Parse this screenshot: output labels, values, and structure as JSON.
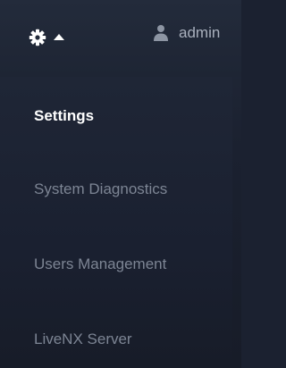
{
  "header": {
    "settings_icon": "gear-icon",
    "toggle_icon": "caret-up-icon",
    "user_icon": "user-icon",
    "username": "admin"
  },
  "menu": {
    "items": [
      {
        "label": "Settings",
        "active": true
      },
      {
        "label": "System Diagnostics",
        "active": false
      },
      {
        "label": "Users Management",
        "active": false
      },
      {
        "label": "LiveNX Server",
        "active": false
      }
    ]
  },
  "colors": {
    "background": "#1b2130",
    "active_text": "#ffffff",
    "inactive_text": "#7d8594"
  }
}
